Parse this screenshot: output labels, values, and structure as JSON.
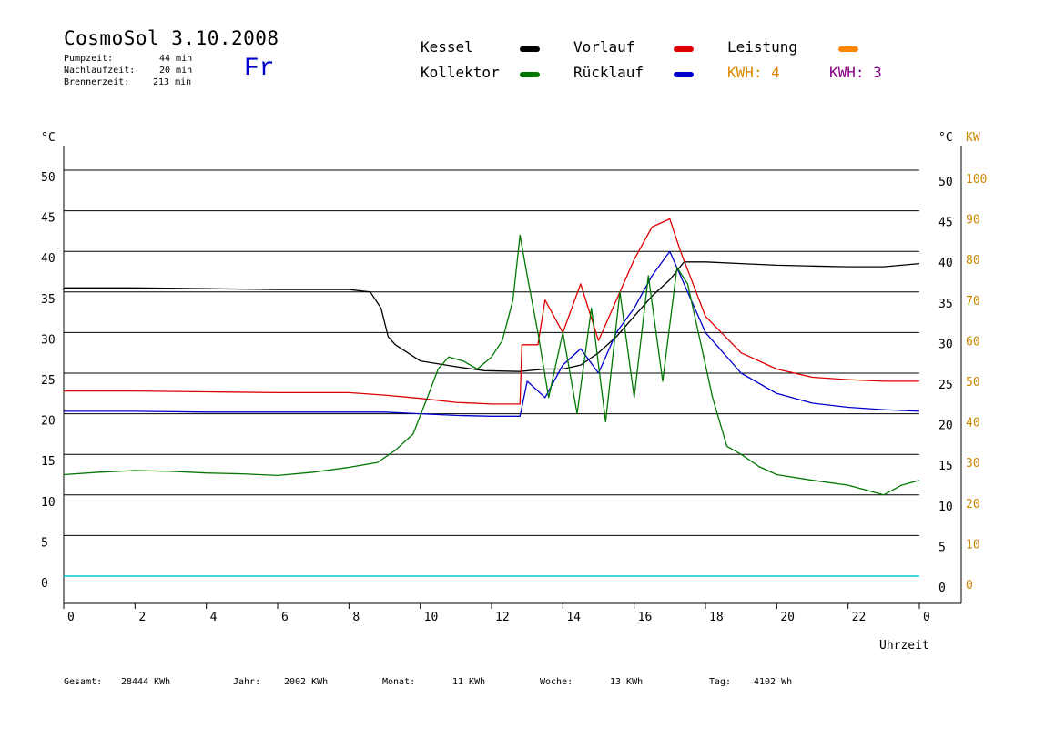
{
  "header": {
    "title": "CosmoSol 3.10.2008",
    "day": "Fr",
    "stats": [
      {
        "label": "Pumpzeit:",
        "value": "44 min"
      },
      {
        "label": "Nachlaufzeit:",
        "value": "20 min"
      },
      {
        "label": "Brennerzeit:",
        "value": "213 min"
      }
    ]
  },
  "legend": [
    {
      "label": "Kessel",
      "color": "#000000"
    },
    {
      "label": "Vorlauf",
      "color": "#dd0000"
    },
    {
      "label": "Leistung",
      "color": "#ff8800"
    },
    {
      "label": "Kollektor",
      "color": "#007700"
    },
    {
      "label": "Rücklauf",
      "color": "#0000cc"
    }
  ],
  "kwh": [
    {
      "label": "KWH: 4",
      "color": "#dd8800"
    },
    {
      "label": "KWH: 3",
      "color": "#880088"
    }
  ],
  "axes": {
    "left_unit": "°C",
    "right_unit": "°C",
    "right_unit2": "KW",
    "x_label": "Uhrzeit"
  },
  "footer": [
    {
      "label": "Gesamt:",
      "value": "28444 KWh"
    },
    {
      "label": "Jahr:",
      "value": "2002 KWh"
    },
    {
      "label": "Monat:",
      "value": "11 KWh"
    },
    {
      "label": "Woche:",
      "value": "13 KWh"
    },
    {
      "label": "Tag:",
      "value": "4102 Wh"
    }
  ],
  "chart_data": {
    "type": "line",
    "xlabel": "Uhrzeit",
    "ylabel": "°C",
    "xlim": [
      0,
      24
    ],
    "ylim": [
      0,
      50
    ],
    "y2lim": [
      0,
      100
    ],
    "x_ticks": [
      "0",
      "2",
      "4",
      "6",
      "8",
      "10",
      "12",
      "14",
      "16",
      "18",
      "20",
      "22",
      "0"
    ],
    "y_ticks": [
      "0",
      "5",
      "10",
      "15",
      "20",
      "25",
      "30",
      "35",
      "40",
      "45",
      "50"
    ],
    "y2_ticks": [
      "0",
      "10",
      "20",
      "30",
      "40",
      "50",
      "60",
      "70",
      "80",
      "90",
      "100"
    ],
    "grid": true,
    "series": [
      {
        "name": "Kessel",
        "color": "#000000",
        "x": [
          0,
          2,
          4,
          6,
          8,
          8.6,
          8.9,
          9.1,
          9.3,
          10,
          11,
          11.8,
          12.8,
          13.5,
          14,
          14.5,
          15,
          15.5,
          16,
          16.5,
          17,
          17.4,
          18,
          19,
          20,
          21,
          22,
          23,
          24
        ],
        "y": [
          35.5,
          35.5,
          35.4,
          35.3,
          35.3,
          35.0,
          33.0,
          29.5,
          28.5,
          26.5,
          25.8,
          25.3,
          25.2,
          25.5,
          25.5,
          26.0,
          27.5,
          29.5,
          32.0,
          34.5,
          36.5,
          38.7,
          38.7,
          38.5,
          38.3,
          38.2,
          38.1,
          38.1,
          38.5
        ]
      },
      {
        "name": "Vorlauf",
        "color": "#dd0000",
        "x": [
          0,
          2,
          4,
          6,
          8,
          9,
          10,
          11,
          12,
          12.8,
          12.85,
          13.3,
          13.5,
          14,
          14.5,
          15,
          15.5,
          16,
          16.5,
          17,
          17.3,
          18,
          19,
          20,
          21,
          22,
          23,
          24
        ],
        "y": [
          22.8,
          22.8,
          22.7,
          22.6,
          22.6,
          22.3,
          21.9,
          21.4,
          21.2,
          21.2,
          28.5,
          28.5,
          34.0,
          30.0,
          36.0,
          29.0,
          34.0,
          39.0,
          43.0,
          44.0,
          40.0,
          32.0,
          27.5,
          25.5,
          24.5,
          24.2,
          24.0,
          24.0
        ]
      },
      {
        "name": "Rücklauf",
        "color": "#0000cc",
        "x": [
          0,
          2,
          4,
          6,
          8,
          9,
          10,
          11,
          12,
          12.8,
          13.0,
          13.5,
          14,
          14.5,
          15,
          15.5,
          16,
          16.5,
          17,
          17.3,
          18,
          19,
          20,
          21,
          22,
          23,
          24
        ],
        "y": [
          20.3,
          20.3,
          20.2,
          20.2,
          20.2,
          20.2,
          20.0,
          19.8,
          19.7,
          19.7,
          24.0,
          22.0,
          26.0,
          28.0,
          25.0,
          30.0,
          33.0,
          37.0,
          40.0,
          37.0,
          30.0,
          25.0,
          22.5,
          21.3,
          20.8,
          20.5,
          20.3
        ]
      },
      {
        "name": "Kollektor",
        "color": "#007700",
        "x": [
          0,
          1,
          2,
          3,
          4,
          5,
          6,
          7,
          8,
          8.8,
          9.3,
          9.8,
          10.2,
          10.5,
          10.8,
          11.2,
          11.6,
          12.0,
          12.3,
          12.6,
          12.8,
          13.0,
          13.3,
          13.6,
          14,
          14.4,
          14.8,
          15.2,
          15.6,
          16,
          16.4,
          16.8,
          17.2,
          17.5,
          17.8,
          18.2,
          18.6,
          19,
          19.5,
          20,
          21,
          22,
          22.5,
          23,
          23.5,
          24
        ],
        "y": [
          12.5,
          12.8,
          13.0,
          12.9,
          12.7,
          12.6,
          12.4,
          12.8,
          13.4,
          14.0,
          15.5,
          17.5,
          22.0,
          25.5,
          27.0,
          26.5,
          25.5,
          27.0,
          29.0,
          34.0,
          42.0,
          37.0,
          30.0,
          22.0,
          30.0,
          20.0,
          33.0,
          19.0,
          35.0,
          22.0,
          37.0,
          24.0,
          38.0,
          36.0,
          30.0,
          22.0,
          16.0,
          15.0,
          13.5,
          12.5,
          11.8,
          11.2,
          10.6,
          10.0,
          11.2,
          11.8
        ]
      }
    ]
  }
}
